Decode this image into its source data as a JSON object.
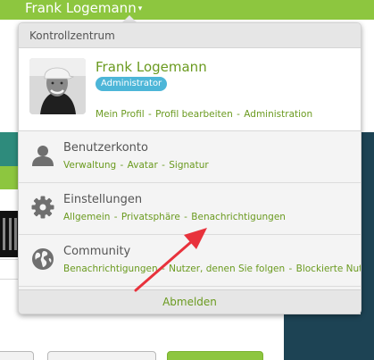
{
  "topbar": {
    "user_name": "Frank Logemann",
    "chevron": "▾"
  },
  "panel": {
    "header": "Kontrollzentrum",
    "profile": {
      "name": "Frank Logemann",
      "role": "Administrator",
      "links": [
        "Mein Profil",
        "Profil bearbeiten",
        "Administration"
      ]
    },
    "sections": [
      {
        "icon": "user-icon",
        "title": "Benutzerkonto",
        "links": [
          "Verwaltung",
          "Avatar",
          "Signatur"
        ]
      },
      {
        "icon": "gear-icon",
        "title": "Einstellungen",
        "links": [
          "Allgemein",
          "Privatsphäre",
          "Benachrichtigungen"
        ]
      },
      {
        "icon": "globe-icon",
        "title": "Community",
        "links": [
          "Benachrichtigungen",
          "Nutzer, denen Sie folgen",
          "Blockierte Nutzer"
        ]
      }
    ],
    "logout": "Abmelden"
  },
  "separator": "-",
  "colors": {
    "brand_green": "#8dc63f",
    "link_green": "#6a9a1f",
    "badge_blue": "#4db6d8",
    "annotation_arrow": "#e8323c",
    "dark_teal": "#1d4354"
  }
}
